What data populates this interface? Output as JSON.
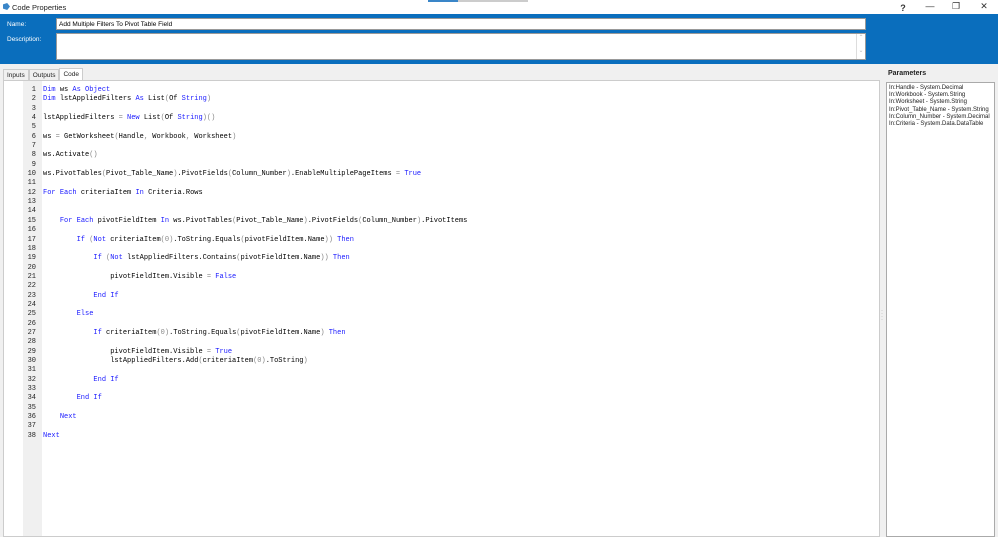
{
  "window": {
    "title": "Code Properties",
    "help": "?",
    "minimize": "—",
    "restore": "❐",
    "close": "✕"
  },
  "header": {
    "name_label": "Name:",
    "name_value": "Add Multiple Filters To Pivot Table Field",
    "description_label": "Description:",
    "description_value": ""
  },
  "tabs": [
    {
      "label": "Inputs"
    },
    {
      "label": "Outputs"
    },
    {
      "label": "Code",
      "active": true
    }
  ],
  "code": {
    "lines": [
      "Dim ws As Object",
      "Dim lstAppliedFilters As List(Of String)",
      "",
      "lstAppliedFilters = New List(Of String)()",
      "",
      "ws = GetWorksheet(Handle, Workbook, Worksheet)",
      "",
      "ws.Activate()",
      "",
      "ws.PivotTables(Pivot_Table_Name).PivotFields(Column_Number).EnableMultiplePageItems = True",
      "",
      "For Each criteriaItem In Criteria.Rows",
      "",
      "",
      "    For Each pivotFieldItem In ws.PivotTables(Pivot_Table_Name).PivotFields(Column_Number).PivotItems",
      "",
      "        If (Not criteriaItem(0).ToString.Equals(pivotFieldItem.Name)) Then",
      "",
      "            If (Not lstAppliedFilters.Contains(pivotFieldItem.Name)) Then",
      "",
      "                pivotFieldItem.Visible = False",
      "",
      "            End If",
      "",
      "        Else",
      "",
      "            If criteriaItem(0).ToString.Equals(pivotFieldItem.Name) Then",
      "",
      "                pivotFieldItem.Visible = True",
      "                lstAppliedFilters.Add(criteriaItem(0).ToString)",
      "",
      "            End If",
      "",
      "        End If",
      "",
      "    Next",
      "",
      "Next"
    ],
    "keywords": [
      "Dim",
      "As",
      "Object",
      "String",
      "New",
      "True",
      "False",
      "For",
      "Each",
      "In",
      "If",
      "Not",
      "Then",
      "End",
      "Else",
      "Next"
    ]
  },
  "parameters": {
    "title": "Parameters",
    "items": [
      "In:Handle - System.Decimal",
      "In:Workbook - System.String",
      "In:Worksheet - System.String",
      "In:Pivot_Table_Name - System.String",
      "In:Column_Number - System.Decimal",
      "In:Criteria - System.Data.DataTable"
    ]
  }
}
